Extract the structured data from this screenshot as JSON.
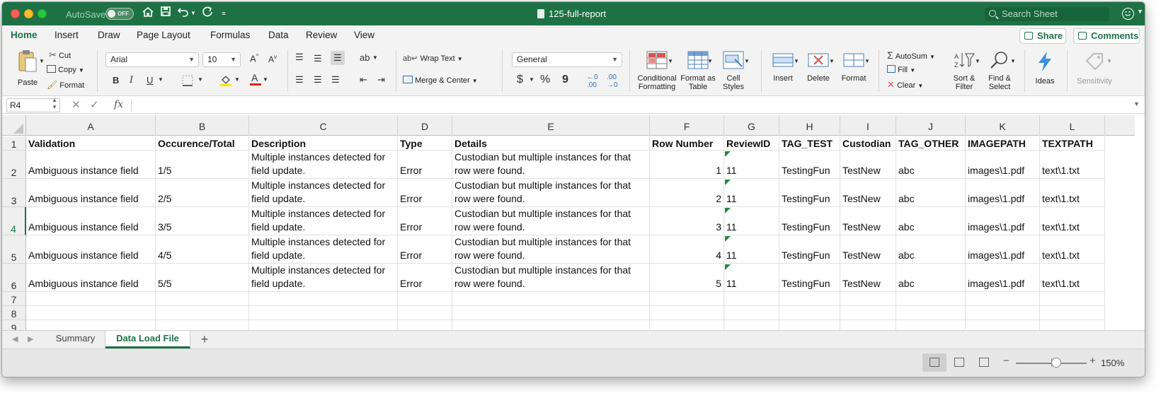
{
  "titlebar": {
    "autosave_label": "AutoSave",
    "autosave_state": "OFF",
    "document_title": "125-full-report",
    "search_placeholder": "Search Sheet"
  },
  "ribbon_tabs": [
    "Home",
    "Insert",
    "Draw",
    "Page Layout",
    "Formulas",
    "Data",
    "Review",
    "View"
  ],
  "active_tab": "Home",
  "share_label": "Share",
  "comments_label": "Comments",
  "ribbon": {
    "paste": "Paste",
    "cut": "Cut",
    "copy": "Copy",
    "format_painter": "Format",
    "font_name": "Arial",
    "font_size": "10",
    "bold": "B",
    "italic": "I",
    "underline": "U",
    "wrap_text": "Wrap Text",
    "merge_center": "Merge & Center",
    "number_format": "General",
    "currency": "$",
    "percent": "%",
    "comma": "9",
    "conditional_formatting": "Conditional Formatting",
    "format_as_table": "Format as Table",
    "cell_styles": "Cell Styles",
    "insert": "Insert",
    "delete": "Delete",
    "format": "Format",
    "autosum": "AutoSum",
    "fill": "Fill",
    "clear": "Clear",
    "sort_filter": "Sort & Filter",
    "find_select": "Find & Select",
    "ideas": "Ideas",
    "sensitivity": "Sensitivity"
  },
  "formula_bar": {
    "name_box": "R4",
    "fx": "fx",
    "content": ""
  },
  "columns": [
    "A",
    "B",
    "C",
    "D",
    "E",
    "F",
    "G",
    "H",
    "I",
    "J",
    "K",
    "L"
  ],
  "rows": [
    "1",
    "2",
    "3",
    "4",
    "5",
    "6",
    "7",
    "8",
    "9"
  ],
  "header_row": [
    "Validation",
    "Occurence/Total",
    "Description",
    "Type",
    "Details",
    "Row Number",
    "ReviewID",
    "TAG_TEST",
    "Custodian",
    "TAG_OTHER",
    "IMAGEPATH",
    "TEXTPATH"
  ],
  "data_rows": [
    [
      "Ambiguous instance field",
      "1/5",
      "Multiple instances detected for field update.",
      "Error",
      "Custodian but multiple instances for that row were found.",
      "1",
      "11",
      "TestingFun",
      "TestNew",
      "abc",
      "images\\1.pdf",
      "text\\1.txt"
    ],
    [
      "Ambiguous instance field",
      "2/5",
      "Multiple instances detected for field update.",
      "Error",
      "Custodian but multiple instances for that row were found.",
      "2",
      "11",
      "TestingFun",
      "TestNew",
      "abc",
      "images\\1.pdf",
      "text\\1.txt"
    ],
    [
      "Ambiguous instance field",
      "3/5",
      "Multiple instances detected for field update.",
      "Error",
      "Custodian but multiple instances for that row were found.",
      "3",
      "11",
      "TestingFun",
      "TestNew",
      "abc",
      "images\\1.pdf",
      "text\\1.txt"
    ],
    [
      "Ambiguous instance field",
      "4/5",
      "Multiple instances detected for field update.",
      "Error",
      "Custodian but multiple instances for that row were found.",
      "4",
      "11",
      "TestingFun",
      "TestNew",
      "abc",
      "images\\1.pdf",
      "text\\1.txt"
    ],
    [
      "Ambiguous instance field",
      "5/5",
      "Multiple instances detected for field update.",
      "Error",
      "Custodian but multiple instances for that row were found.",
      "5",
      "11",
      "TestingFun",
      "TestNew",
      "abc",
      "images\\1.pdf",
      "text\\1.txt"
    ]
  ],
  "selected_row": "4",
  "sheet_tabs": [
    "Summary",
    "Data Load File"
  ],
  "active_sheet": "Data Load File",
  "status": {
    "zoom": "150%"
  },
  "colors": {
    "brand_green": "#1e7145",
    "number_stored_as_text_marker": "#1f8a3b"
  }
}
